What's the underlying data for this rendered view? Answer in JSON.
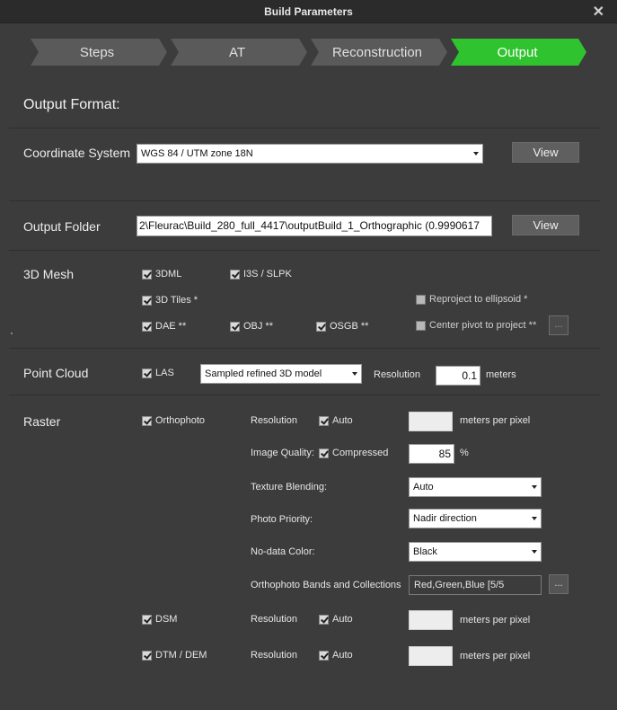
{
  "window": {
    "title": "Build Parameters",
    "close_glyph": "✕"
  },
  "steps": [
    {
      "label": "Steps",
      "active": false
    },
    {
      "label": "AT",
      "active": false
    },
    {
      "label": "Reconstruction",
      "active": false
    },
    {
      "label": "Output",
      "active": true
    }
  ],
  "colors": {
    "active_step": "#2fc42f",
    "inactive_step": "#5a5a5a",
    "background": "#3c3c3c"
  },
  "output_format": {
    "heading": "Output Format:"
  },
  "coordinate_system": {
    "label": "Coordinate System",
    "value": "WGS 84 / UTM zone 18N",
    "view_label": "View"
  },
  "output_folder": {
    "label": "Output Folder",
    "value": "2\\Fleurac\\Build_280_full_4417\\outputBuild_1_Orthographic (0.9990617",
    "view_label": "View"
  },
  "mesh": {
    "label": "3D Mesh",
    "3dml": {
      "label": "3DML",
      "checked": true
    },
    "i3s": {
      "label": "I3S / SLPK",
      "checked": true
    },
    "tiles": {
      "label": "3D Tiles *",
      "checked": true
    },
    "dae": {
      "label": "DAE **",
      "checked": true
    },
    "obj": {
      "label": "OBJ **",
      "checked": true
    },
    "osgb": {
      "label": "OSGB **",
      "checked": true
    },
    "reproject": {
      "label": "Reproject to ellipsoid *",
      "checked": false
    },
    "center_pivot": {
      "label": "Center pivot to project **",
      "checked": false
    },
    "ellipsis": "..."
  },
  "point_cloud": {
    "label": "Point Cloud",
    "las": {
      "label": "LAS",
      "checked": true
    },
    "source": "Sampled refined 3D model",
    "resolution_label": "Resolution",
    "resolution_value": "0.1",
    "unit": "meters"
  },
  "raster": {
    "label": "Raster",
    "orthophoto": {
      "label": "Orthophoto",
      "checked": true,
      "resolution_label": "Resolution",
      "auto": {
        "label": "Auto",
        "checked": true
      },
      "resolution_value": "",
      "unit": "meters per pixel",
      "quality_label": "Image Quality:",
      "compressed": {
        "label": "Compressed",
        "checked": true
      },
      "quality_value": "85",
      "quality_unit": "%",
      "texture_blending_label": "Texture Blending:",
      "texture_blending_value": "Auto",
      "photo_priority_label": "Photo Priority:",
      "photo_priority_value": "Nadir direction",
      "nodata_label": "No-data Color:",
      "nodata_value": "Black",
      "bands_label": "Orthophoto Bands and Collections",
      "bands_value": "Red,Green,Blue [5/5",
      "ellipsis": "..."
    },
    "dsm": {
      "label": "DSM",
      "checked": true,
      "resolution_label": "Resolution",
      "auto": {
        "label": "Auto",
        "checked": true
      },
      "resolution_value": "",
      "unit": "meters per pixel"
    },
    "dtm": {
      "label": "DTM / DEM",
      "checked": true,
      "resolution_label": "Resolution",
      "auto": {
        "label": "Auto",
        "checked": true
      },
      "resolution_value": "",
      "unit": "meters per pixel"
    }
  }
}
